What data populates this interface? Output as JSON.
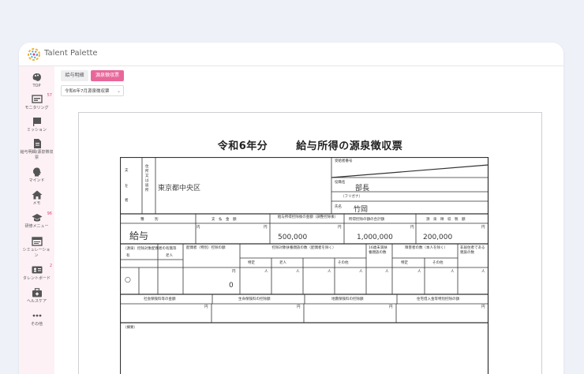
{
  "app": {
    "brand": "Talent Palette"
  },
  "sidebar": {
    "items": [
      {
        "label": "TOP",
        "icon": "palette-icon",
        "badge": ""
      },
      {
        "label": "モニタリング",
        "icon": "monitor-icon",
        "badge": "57"
      },
      {
        "label": "ミッション",
        "icon": "flag-icon",
        "badge": ""
      },
      {
        "label": "給与明細/源泉徴収票",
        "icon": "document-icon",
        "badge": ""
      },
      {
        "label": "マインド",
        "icon": "head-icon",
        "badge": ""
      },
      {
        "label": "メモ",
        "icon": "home-icon",
        "badge": ""
      },
      {
        "label": "研修メニュー",
        "icon": "graduation-cap-icon",
        "badge": "96"
      },
      {
        "label": "シミュレーション",
        "icon": "simulation-icon",
        "badge": ""
      },
      {
        "label": "タレントボード",
        "icon": "id-card-icon",
        "badge": "2"
      },
      {
        "label": "ヘルスケア",
        "icon": "briefcase-icon",
        "badge": ""
      },
      {
        "label": "その他",
        "icon": "more-icon",
        "badge": ""
      }
    ]
  },
  "tabs": [
    {
      "label": "給与明細"
    },
    {
      "label": "源泉徴収票"
    }
  ],
  "year_select": {
    "value": "令和6年7月源泉徴収票"
  },
  "document": {
    "title_year": "令和6年分",
    "title_main": "給与所得の源泉徴収票",
    "labels": {
      "pay_to": [
        "支",
        "払",
        "を",
        "受",
        "け",
        "る",
        "者"
      ],
      "address": "住所又は居所",
      "beneficiary_no": "受給者番号",
      "role": "役職名",
      "name_kana": "（フリガナ）",
      "name_label": "氏名",
      "kind": "種　　　別",
      "payment": "支　払　金　額",
      "after_deduction": "給与所得控除後の金額（調整控除後）",
      "deduction_total": "所得控除の額の合計額",
      "withholding": "源　泉　徴　収　税　額",
      "spouse": "（源泉）控除対象配偶者の有無等",
      "spouse_special": "配偶者（特別）控除の額",
      "dependents": "控除対象扶養親族の数（配偶者を除く）",
      "under16": "16歳未満扶養親族の数",
      "disabled": "障害者の数（本人を除く）",
      "nonresident": "非居住者である親族の数",
      "have": "有",
      "elderly": "老人",
      "special": "特定",
      "other": "その他",
      "people": "人",
      "insurance": "社会保険料等の金額",
      "life_insurance": "生命保険料の控除額",
      "earthquake": "地震保険料の控除額",
      "housing": "住宅借入金等特別控除の額",
      "summary": "（摘要）",
      "yen": "円",
      "thousand": "千"
    },
    "values": {
      "address": "東京都中央区",
      "role": "部長",
      "name": "竹岡",
      "kind": "給与",
      "payment": "500,000",
      "after_deduction": "1,000,000",
      "deduction_total": "200,000",
      "withholding": "",
      "spouse_mark": "○",
      "spouse_special": "0",
      "inner": "内"
    }
  }
}
